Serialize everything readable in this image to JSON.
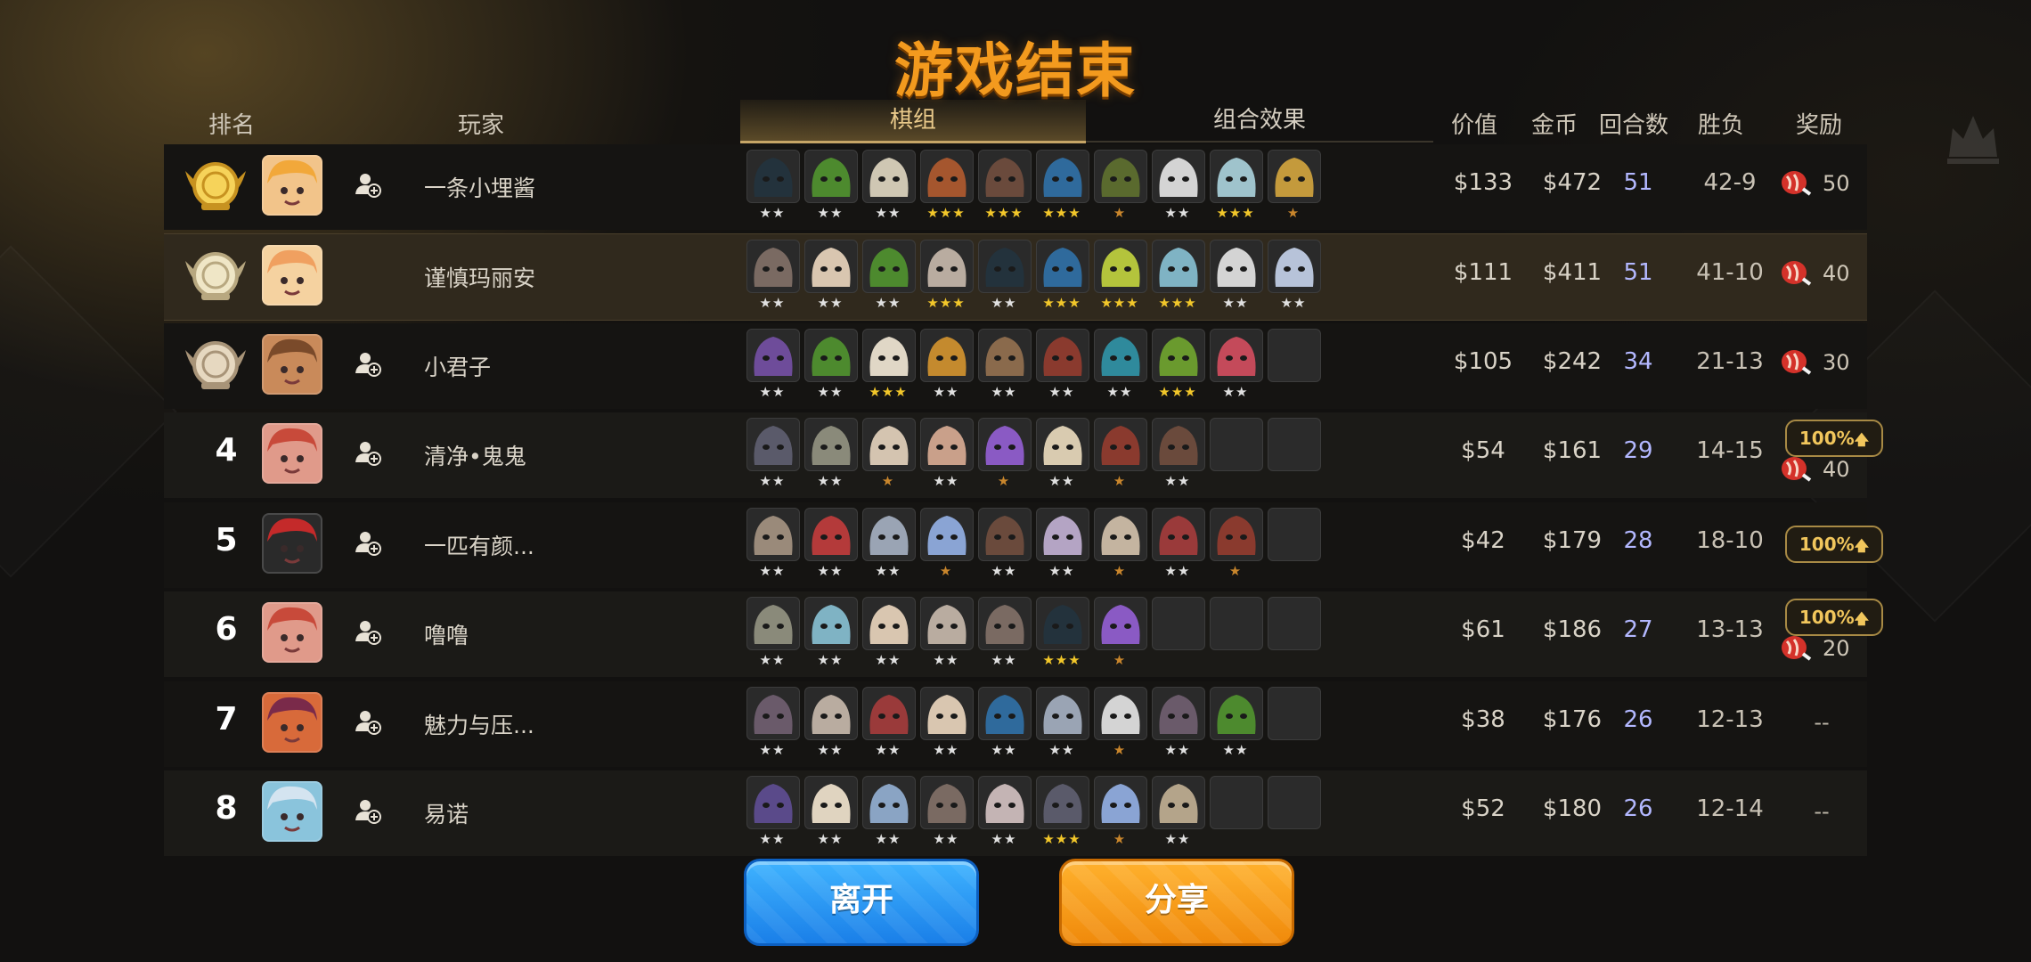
{
  "title": "游戏结束",
  "headers": {
    "rank": "排名",
    "player": "玩家",
    "value": "价值",
    "gold": "金币",
    "rounds": "回合数",
    "winloss": "胜负",
    "reward": "奖励"
  },
  "tabs": [
    {
      "label": "棋组",
      "active": true
    },
    {
      "label": "组合效果",
      "active": false
    }
  ],
  "buttons": {
    "leave": "离开",
    "share": "分享"
  },
  "rows": [
    {
      "rank": "1",
      "medal": "gold",
      "name": "一条小埋酱",
      "add_friend": true,
      "value": "$133",
      "gold": "$472",
      "rounds": "51",
      "winloss": "42-9",
      "reward": {
        "boost": null,
        "amount": "50"
      },
      "units": [
        {
          "color": "#23323c",
          "stars": 2
        },
        {
          "color": "#4d8a2e",
          "stars": 2
        },
        {
          "color": "#cfc7b3",
          "stars": 2
        },
        {
          "color": "#a5562e",
          "stars": 3
        },
        {
          "color": "#6a4a3c",
          "stars": 3
        },
        {
          "color": "#2f6a9c",
          "stars": 3
        },
        {
          "color": "#5a6a2e",
          "stars": 1
        },
        {
          "color": "#d4d4d4",
          "stars": 2
        },
        {
          "color": "#9fc3cc",
          "stars": 3
        },
        {
          "color": "#c49a3c",
          "stars": 1
        }
      ]
    },
    {
      "rank": "2",
      "medal": "silver",
      "name": "谨慎玛丽安",
      "add_friend": false,
      "value": "$111",
      "gold": "$411",
      "rounds": "51",
      "winloss": "41-10",
      "reward": {
        "boost": null,
        "amount": "40"
      },
      "units": [
        {
          "color": "#7a6a62",
          "stars": 2
        },
        {
          "color": "#d9c6b0",
          "stars": 2
        },
        {
          "color": "#4d8a2e",
          "stars": 2
        },
        {
          "color": "#b9aca0",
          "stars": 3
        },
        {
          "color": "#23323c",
          "stars": 2
        },
        {
          "color": "#2f6a9c",
          "stars": 3
        },
        {
          "color": "#b4c43c",
          "stars": 3
        },
        {
          "color": "#7fb3c4",
          "stars": 3
        },
        {
          "color": "#d4d4d4",
          "stars": 2
        },
        {
          "color": "#b7c3d9",
          "stars": 2
        }
      ]
    },
    {
      "rank": "3",
      "medal": "bronze",
      "name": "小君子",
      "add_friend": true,
      "value": "$105",
      "gold": "$242",
      "rounds": "34",
      "winloss": "21-13",
      "reward": {
        "boost": null,
        "amount": "30"
      },
      "units": [
        {
          "color": "#6e4c9a",
          "stars": 2
        },
        {
          "color": "#4d8a2e",
          "stars": 2
        },
        {
          "color": "#e0d7c6",
          "stars": 3
        },
        {
          "color": "#c48a2e",
          "stars": 2
        },
        {
          "color": "#8a6a4c",
          "stars": 2
        },
        {
          "color": "#8a3a2e",
          "stars": 2
        },
        {
          "color": "#2f8a9c",
          "stars": 2
        },
        {
          "color": "#6a9a2e",
          "stars": 3
        },
        {
          "color": "#c44a5a",
          "stars": 2
        },
        {
          "color": "",
          "stars": 0
        }
      ]
    },
    {
      "rank": "4",
      "medal": null,
      "name": "清净•鬼鬼",
      "add_friend": true,
      "value": "$54",
      "gold": "$161",
      "rounds": "29",
      "winloss": "14-15",
      "reward": {
        "boost": "100%",
        "amount": "40"
      },
      "units": [
        {
          "color": "#5a5a6a",
          "stars": 2
        },
        {
          "color": "#8a8a7a",
          "stars": 2
        },
        {
          "color": "#d4c4b0",
          "stars": 1
        },
        {
          "color": "#c9a08a",
          "stars": 2
        },
        {
          "color": "#8a5ac4",
          "stars": 1
        },
        {
          "color": "#d9cbb0",
          "stars": 2
        },
        {
          "color": "#8a3a2e",
          "stars": 1
        },
        {
          "color": "#6a4a3c",
          "stars": 2
        },
        {
          "color": "",
          "stars": 0
        },
        {
          "color": "",
          "stars": 0
        }
      ]
    },
    {
      "rank": "5",
      "medal": null,
      "name": "一匹有颜...",
      "add_friend": true,
      "value": "$42",
      "gold": "$179",
      "rounds": "28",
      "winloss": "18-10",
      "reward": {
        "boost": "100%",
        "amount": null
      },
      "units": [
        {
          "color": "#9a8a7a",
          "stars": 2
        },
        {
          "color": "#b43a3a",
          "stars": 2
        },
        {
          "color": "#9aa4b4",
          "stars": 2
        },
        {
          "color": "#8aa4d4",
          "stars": 1
        },
        {
          "color": "#6a4a3c",
          "stars": 2
        },
        {
          "color": "#b4a4c4",
          "stars": 2
        },
        {
          "color": "#c4b4a0",
          "stars": 1
        },
        {
          "color": "#9a3a3a",
          "stars": 2
        },
        {
          "color": "#8a3a2e",
          "stars": 1
        },
        {
          "color": "",
          "stars": 0
        }
      ]
    },
    {
      "rank": "6",
      "medal": null,
      "name": "噜噜",
      "add_friend": true,
      "value": "$61",
      "gold": "$186",
      "rounds": "27",
      "winloss": "13-13",
      "reward": {
        "boost": "100%",
        "amount": "20"
      },
      "units": [
        {
          "color": "#8a8a7a",
          "stars": 2
        },
        {
          "color": "#7fb3c4",
          "stars": 2
        },
        {
          "color": "#d9c6b0",
          "stars": 2
        },
        {
          "color": "#b9aca0",
          "stars": 2
        },
        {
          "color": "#7a6a62",
          "stars": 2
        },
        {
          "color": "#23323c",
          "stars": 3
        },
        {
          "color": "#8a5ac4",
          "stars": 1
        },
        {
          "color": "",
          "stars": 0
        },
        {
          "color": "",
          "stars": 0
        },
        {
          "color": "",
          "stars": 0
        }
      ]
    },
    {
      "rank": "7",
      "medal": null,
      "name": "魅力与压...",
      "add_friend": true,
      "value": "$38",
      "gold": "$176",
      "rounds": "26",
      "winloss": "12-13",
      "reward": {
        "boost": null,
        "amount": null,
        "dash": "--"
      },
      "units": [
        {
          "color": "#6a5a6a",
          "stars": 2
        },
        {
          "color": "#b9aca0",
          "stars": 2
        },
        {
          "color": "#9a3a3a",
          "stars": 2
        },
        {
          "color": "#d9c6b0",
          "stars": 2
        },
        {
          "color": "#2f6a9c",
          "stars": 2
        },
        {
          "color": "#9aa4b4",
          "stars": 2
        },
        {
          "color": "#d4d4d4",
          "stars": 1
        },
        {
          "color": "#6a5a6a",
          "stars": 2
        },
        {
          "color": "#4d8a2e",
          "stars": 2
        },
        {
          "color": "",
          "stars": 0
        }
      ]
    },
    {
      "rank": "8",
      "medal": null,
      "name": "易诺",
      "add_friend": true,
      "value": "$52",
      "gold": "$180",
      "rounds": "26",
      "winloss": "12-14",
      "reward": {
        "boost": null,
        "amount": null,
        "dash": "--"
      },
      "units": [
        {
          "color": "#5a4a8a",
          "stars": 2
        },
        {
          "color": "#e0d4c0",
          "stars": 2
        },
        {
          "color": "#8aa4c4",
          "stars": 2
        },
        {
          "color": "#7a6a62",
          "stars": 2
        },
        {
          "color": "#c4b4b4",
          "stars": 2
        },
        {
          "color": "#5a5a6a",
          "stars": 3
        },
        {
          "color": "#8aa4d4",
          "stars": 1
        },
        {
          "color": "#b4a48a",
          "stars": 2
        },
        {
          "color": "",
          "stars": 0
        },
        {
          "color": "",
          "stars": 0
        }
      ]
    }
  ],
  "colors": {
    "title": "#f39a1e",
    "rounds": "#b3b8ff",
    "boost_border": "#a88a45",
    "leave_button": "#1a7fe8",
    "share_button": "#f08a0b"
  },
  "avatars": [
    {
      "bg": "#f2c48a",
      "hair": "#f2a83a"
    },
    {
      "bg": "#f5d2a0",
      "hair": "#f0a060"
    },
    {
      "bg": "#c98a5a",
      "hair": "#7a4a2a"
    },
    {
      "bg": "#e09a8a",
      "hair": "#c84a3a"
    },
    {
      "bg": "#2a2a2a",
      "hair": "#c42a2a"
    },
    {
      "bg": "#e09a8a",
      "hair": "#c84a3a"
    },
    {
      "bg": "#d86a3a",
      "hair": "#7a2a4a"
    },
    {
      "bg": "#8ac4dc",
      "hair": "#d4e4f0"
    }
  ]
}
